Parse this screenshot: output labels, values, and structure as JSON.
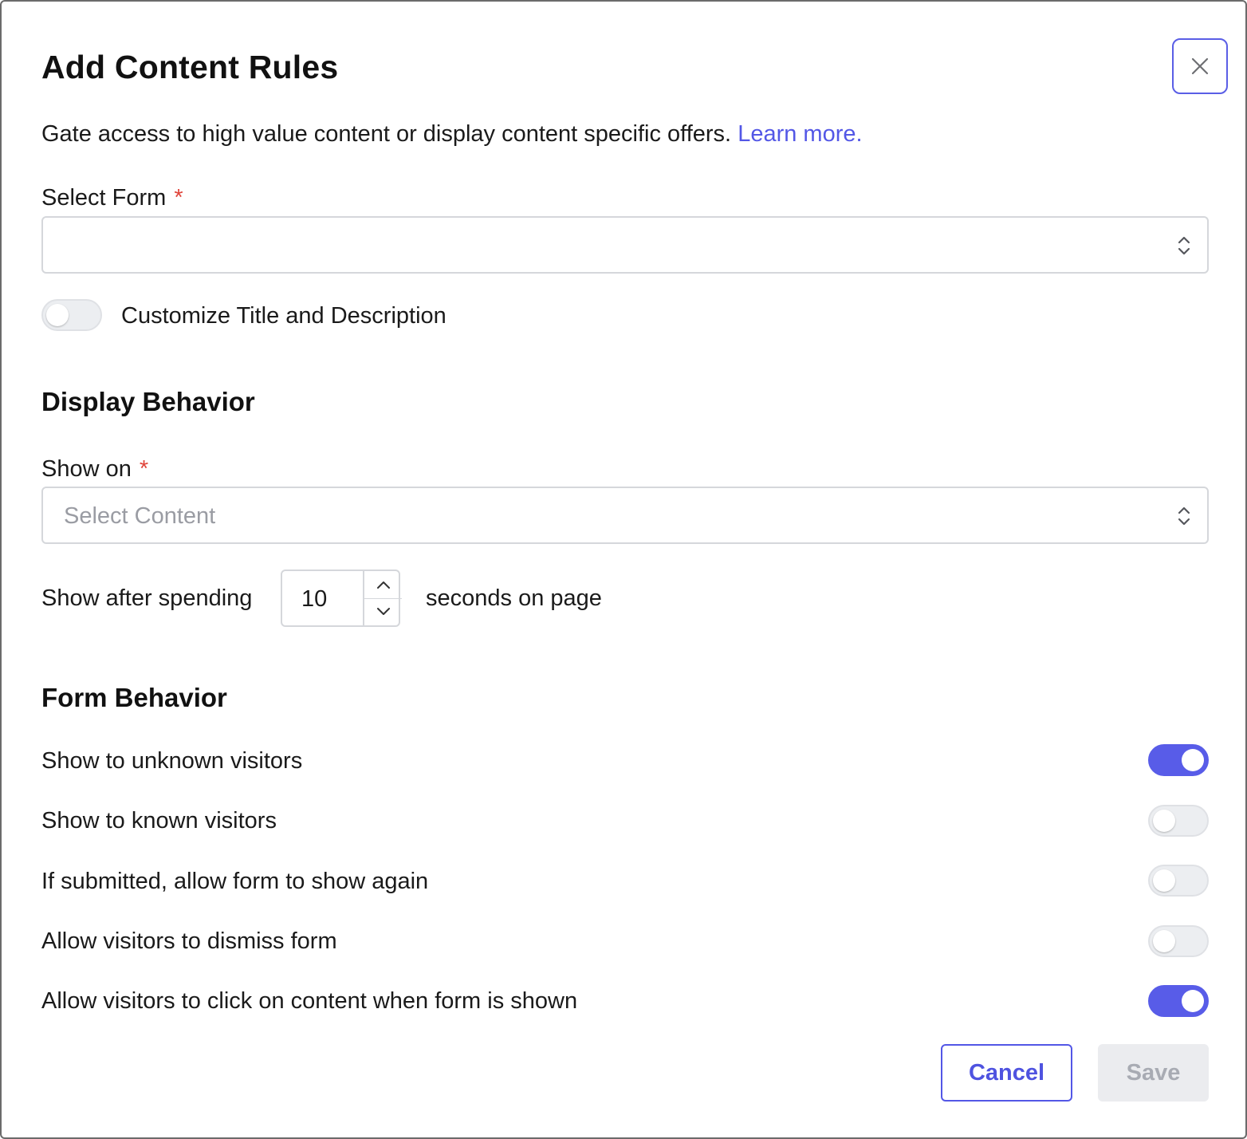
{
  "dialog": {
    "title": "Add Content Rules",
    "description": "Gate access to high value content or display content specific offers.",
    "learn_more": "Learn more.",
    "close_icon": "close-icon"
  },
  "select_form": {
    "label": "Select Form",
    "required_mark": "*",
    "value": ""
  },
  "customize": {
    "label": "Customize Title and Description",
    "enabled": false
  },
  "display_behavior": {
    "heading": "Display Behavior",
    "show_on": {
      "label": "Show on",
      "required_mark": "*",
      "placeholder": "Select Content"
    },
    "delay": {
      "prefix": "Show after spending",
      "value": "10",
      "suffix": "seconds on page"
    }
  },
  "form_behavior": {
    "heading": "Form Behavior",
    "options": [
      {
        "label": "Show to unknown visitors",
        "enabled": true
      },
      {
        "label": "Show to known visitors",
        "enabled": false
      },
      {
        "label": "If submitted, allow form to show again",
        "enabled": false
      },
      {
        "label": "Allow visitors to dismiss form",
        "enabled": false
      },
      {
        "label": "Allow visitors to click on content when form is shown",
        "enabled": true
      }
    ]
  },
  "footer": {
    "cancel_label": "Cancel",
    "save_label": "Save",
    "save_disabled": true
  },
  "colors": {
    "accent": "#585ce8",
    "required": "#e0453b",
    "border": "#d5d7db"
  }
}
